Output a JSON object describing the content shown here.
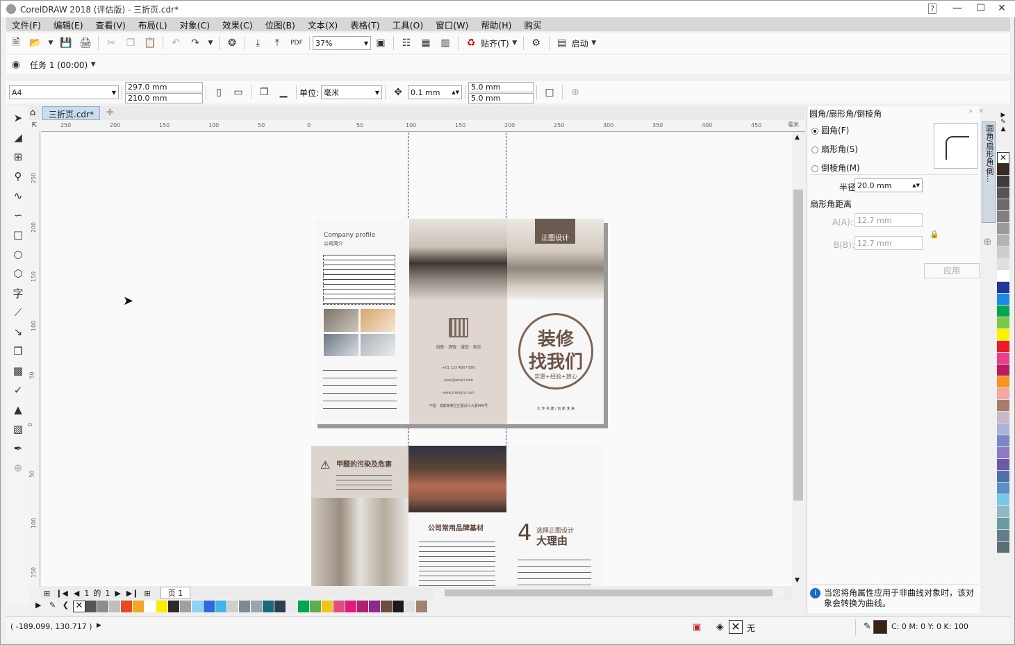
{
  "window": {
    "title": "CorelDRAW 2018 (评估版) - 三折页.cdr*"
  },
  "menu": [
    "文件(F)",
    "编辑(E)",
    "查看(V)",
    "布局(L)",
    "对象(C)",
    "效果(C)",
    "位图(B)",
    "文本(X)",
    "表格(T)",
    "工具(O)",
    "窗口(W)",
    "帮助(H)",
    "购买"
  ],
  "std_toolbar": {
    "zoom": "37%",
    "snap_label": "贴齐(T)",
    "launch_label": "启动"
  },
  "task_bar": {
    "task_label": "任务 1 (00:00)"
  },
  "prop_bar": {
    "page_size": "A4",
    "width": "297.0 mm",
    "height": "210.0 mm",
    "unit_label": "单位:",
    "unit_value": "毫米",
    "nudge": "0.1 mm",
    "dup_x": "5.0 mm",
    "dup_y": "5.0 mm"
  },
  "doc_tab": {
    "name": "三折页.cdr*"
  },
  "ruler": {
    "h_ticks": [
      "250",
      "200",
      "150",
      "100",
      "50",
      "0",
      "50",
      "100",
      "150",
      "200",
      "250",
      "300",
      "350",
      "400",
      "450"
    ],
    "h_unit": "毫米",
    "v_ticks": [
      "250",
      "200",
      "150",
      "100",
      "50",
      "0",
      "50",
      "100",
      "150"
    ]
  },
  "artwork": {
    "company_profile": "Company profile",
    "company_profile_cn": "公司简介",
    "logo_text": "正图设计",
    "headline_1": "装修",
    "headline_2": "找我们",
    "headline_sub": "实惠+经验+放心",
    "slogan": "大 作 共 建  /  创 新 未 来",
    "contact_line": "创新 · 进取 · 诚信 · 务实",
    "phone": "+01 123 4567 890",
    "email": "your@email.com",
    "web": "www.zhengtu.com",
    "address": "中国 · 成都某某区正图设计大厦888号",
    "formaldehyde_title": "甲醛的污染及危害",
    "materials_title": "公司常用品牌基材",
    "reasons_num": "4",
    "reasons_title_1": "选择正图设计",
    "reasons_title_2": "大理由"
  },
  "page_nav": {
    "current": "1",
    "of_label": "的",
    "total": "1",
    "page_tab": "页 1"
  },
  "docker": {
    "title": "圆角/扇形角/倒棱角",
    "side_tab": "圆角/扇形角/倒...",
    "opt_round": "圆角(F)",
    "opt_scallop": "扇形角(S)",
    "opt_chamfer": "倒棱角(M)",
    "radius_label": "半径(R):",
    "radius_value": "20.0 mm",
    "distance_label": "扇形角距离",
    "a_label": "A(A):",
    "a_value": "12.7 mm",
    "b_label": "B(B):",
    "b_value": "12.7 mm",
    "apply_label": "应用",
    "info_text": "当您将角属性应用于非曲线对象时，该对象会转换为曲线。"
  },
  "palette": {
    "right": [
      "#3a2a24",
      "#3d3d3d",
      "#555555",
      "#6b6b6b",
      "#808080",
      "#9a9a9a",
      "#b3b3b3",
      "#cccccc",
      "#e0e0e0",
      "#ffffff",
      "#1f3a93",
      "#1e88e5",
      "#00a651",
      "#7ac943",
      "#fff200",
      "#ed1c24",
      "#e83e8c",
      "#c2185b",
      "#f7941d",
      "#f4a6a0",
      "#a67c6d",
      "#c9b8c8",
      "#a8b4d8",
      "#7b86c9",
      "#8e7bbf",
      "#6a5aa8",
      "#4f6fa8",
      "#5b8fc9",
      "#78c8e8",
      "#8fb8c0",
      "#6a9aa0",
      "#607d8b",
      "#5a6e70"
    ],
    "bottom": [
      "#555555",
      "#8c8c8c",
      "#bfbfbf",
      "#e84c1e",
      "#f5a623",
      "#ffffff",
      "#ffed00",
      "#2b2b2b",
      "#a0a0a0",
      "#8fd3f4",
      "#2d6be4",
      "#41b6e6",
      "#cfcfcf",
      "#7f8c8d",
      "#9aa5b1",
      "#1b6a7a",
      "#2c3e50",
      "#eaeaea",
      "#00a651",
      "#5aaf4e",
      "#f0c419",
      "#e04e7f",
      "#e6197e",
      "#b0226a",
      "#8e2a8f",
      "#6d4c41",
      "#1a1a1a",
      "#e0e0e0",
      "#a0826d"
    ]
  },
  "status": {
    "coords": "( -189.099, 130.717 )",
    "fill_label": "无",
    "color_info": "C: 0 M: 0 Y: 0 K: 100"
  }
}
